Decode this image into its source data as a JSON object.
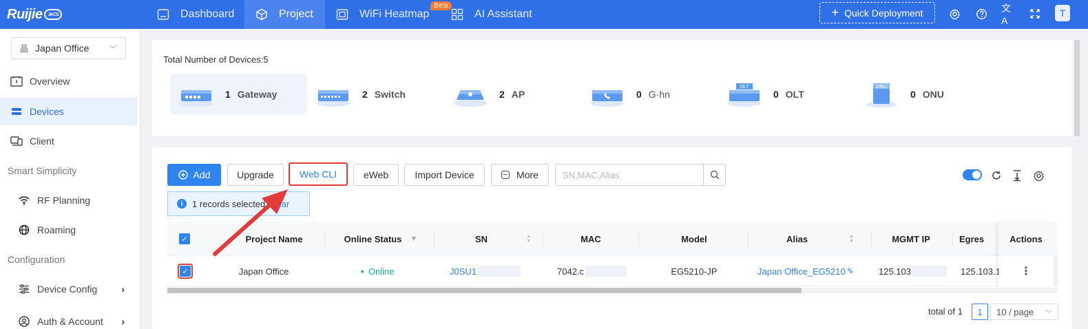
{
  "brand": {
    "name": "Ruijie",
    "cloud_tag": "JeCS"
  },
  "nav": {
    "items": [
      {
        "label": "Dashboard",
        "icon": "dashboard-icon",
        "active": false
      },
      {
        "label": "Project",
        "icon": "cube-icon",
        "active": true
      },
      {
        "label": "WiFi Heatmap",
        "icon": "heatmap-icon",
        "active": false
      },
      {
        "label": "AI Assistant",
        "icon": "grid-icon",
        "active": false
      }
    ],
    "beta_badge": "Beta",
    "quick_deployment": "Quick Deployment",
    "avatar_letter": "T"
  },
  "sidebar": {
    "site": "Japan Office",
    "items": [
      {
        "label": "Overview",
        "icon": "overview-icon"
      },
      {
        "label": "Devices",
        "icon": "devices-icon",
        "active": true
      },
      {
        "label": "Client",
        "icon": "client-icon"
      }
    ],
    "groups": [
      {
        "label": "Smart Simplicity",
        "items": [
          {
            "label": "RF Planning",
            "icon": "wifi-icon"
          },
          {
            "label": "Roaming",
            "icon": "globe-icon"
          }
        ]
      },
      {
        "label": "Configuration",
        "items": [
          {
            "label": "Device Config",
            "icon": "sliders-icon",
            "expandable": true
          },
          {
            "label": "Auth & Account",
            "icon": "user-icon",
            "expandable": true
          }
        ]
      }
    ]
  },
  "summary": {
    "title": "Total Number of Devices:5",
    "tiles": [
      {
        "count": "1",
        "label": "Gateway",
        "active": true
      },
      {
        "count": "2",
        "label": "Switch"
      },
      {
        "count": "2",
        "label": "AP"
      },
      {
        "count": "0",
        "label": "G·hn"
      },
      {
        "count": "0",
        "label": "OLT"
      },
      {
        "count": "0",
        "label": "ONU"
      }
    ]
  },
  "toolbar": {
    "add": "Add",
    "upgrade": "Upgrade",
    "web_cli": "Web CLI",
    "eweb": "eWeb",
    "import_device": "Import Device",
    "more": "More",
    "search_placeholder": "SN,MAC,Alias"
  },
  "selection": {
    "text": "1 records selected",
    "clear": "Clear"
  },
  "table": {
    "headers": {
      "project_name": "Project Name",
      "online_status": "Online Status",
      "sn": "SN",
      "mac": "MAC",
      "model": "Model",
      "alias": "Alias",
      "mgmt_ip": "MGMT IP",
      "egress": "Egres",
      "actions": "Actions"
    },
    "rows": [
      {
        "project_name": "Japan Office",
        "online_status": "Online",
        "sn": "J0SU1",
        "mac": "7042.c",
        "model": "EG5210-JP",
        "alias": "Japan Office_EG5210",
        "mgmt_ip": "125.103",
        "egress": "125.103.1",
        "actions": "⋮"
      }
    ]
  },
  "pagination": {
    "total": "total of 1",
    "page": "1",
    "page_size": "10 / page"
  },
  "colors": {
    "brand": "#2f6fe8",
    "primary": "#2f84f0",
    "online": "#1ab394",
    "annotation": "#e23b3b"
  }
}
